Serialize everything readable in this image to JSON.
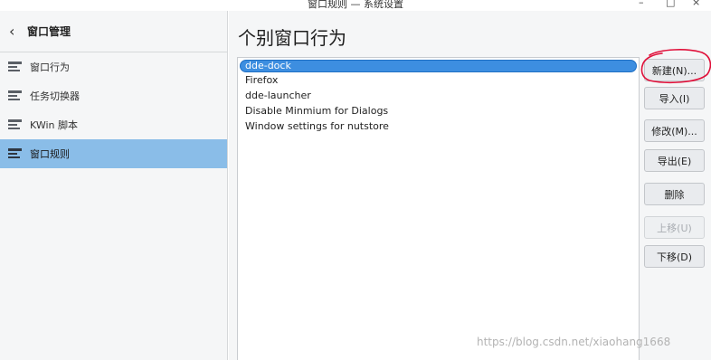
{
  "window": {
    "title": "窗口规则 — 系统设置",
    "controls": {
      "minimize": "–",
      "maximize": "□",
      "close": "×"
    }
  },
  "sidebar": {
    "back_label": "窗口管理",
    "back_icon": "chevron-left-icon",
    "items": [
      {
        "label": "窗口行为",
        "icon": "list-icon"
      },
      {
        "label": "任务切换器",
        "icon": "list-icon"
      },
      {
        "label": "KWin 脚本",
        "icon": "list-icon"
      },
      {
        "label": "窗口规则",
        "icon": "list-icon",
        "active": true
      }
    ]
  },
  "main": {
    "title": "个别窗口行为",
    "rules": [
      {
        "label": "dde-dock",
        "selected": true
      },
      {
        "label": "Firefox"
      },
      {
        "label": "dde-launcher"
      },
      {
        "label": "Disable Minmium for Dialogs"
      },
      {
        "label": "Window settings for nutstore"
      }
    ],
    "buttons": {
      "new": "新建(N)...",
      "import": "导入(I)",
      "modify": "修改(M)...",
      "export": "导出(E)",
      "delete": "删除",
      "move_up": "上移(U)",
      "move_down": "下移(D)"
    }
  },
  "watermark": "https://blog.csdn.net/xiaohang1668",
  "colors": {
    "accent": "#3d8ee0",
    "active_sidebar": "#8abde8",
    "annotation": "#e0103a"
  }
}
